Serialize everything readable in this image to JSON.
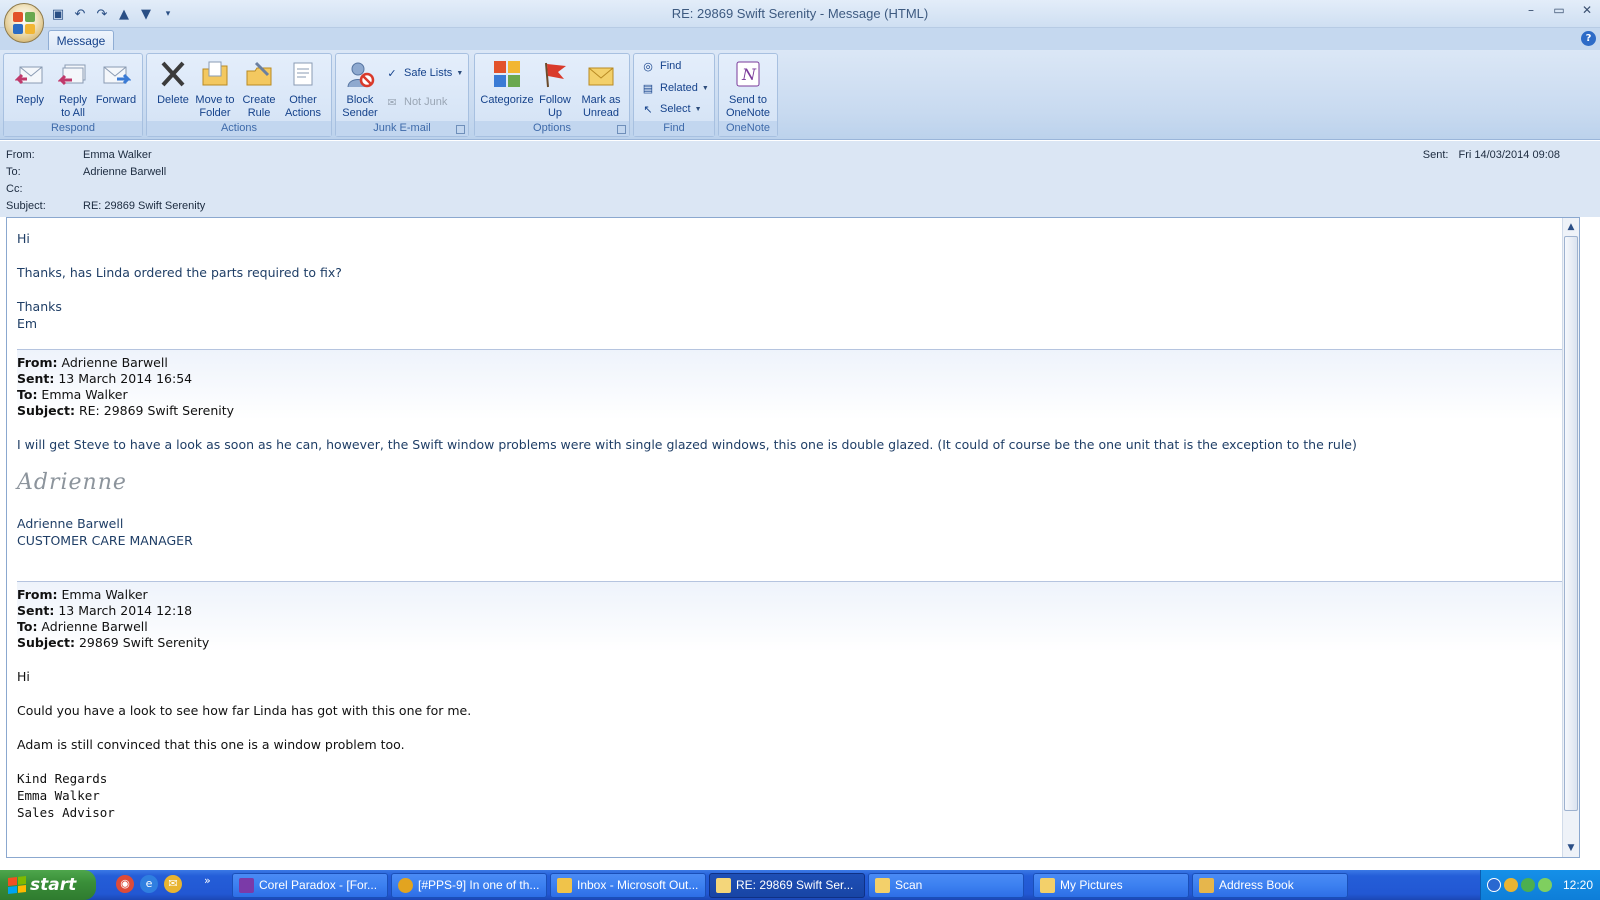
{
  "window": {
    "title": "RE: 29869  Swift Serenity - Message (HTML)",
    "controls": [
      "–",
      "▭",
      "✕"
    ]
  },
  "tabs": [
    {
      "label": "Message"
    }
  ],
  "ribbon": {
    "groups": [
      {
        "label": "Respond",
        "buttons": [
          "Reply",
          "Reply\nto All",
          "Forward"
        ]
      },
      {
        "label": "Actions",
        "buttons": [
          "Delete",
          "Move to\nFolder",
          "Create\nRule",
          "Other\nActions"
        ]
      },
      {
        "label": "Junk E-mail",
        "buttons": [
          "Block\nSender"
        ],
        "small": [
          "Safe Lists",
          "Not Junk"
        ]
      },
      {
        "label": "Options",
        "buttons": [
          "Categorize",
          "Follow\nUp",
          "Mark as\nUnread"
        ]
      },
      {
        "label": "Find",
        "small": [
          "Find",
          "Related",
          "Select"
        ]
      },
      {
        "label": "OneNote",
        "buttons": [
          "Send to\nOneNote"
        ]
      }
    ]
  },
  "header": {
    "from_label": "From:",
    "from": "Emma Walker",
    "to_label": "To:",
    "to": "Adrienne Barwell",
    "cc_label": "Cc:",
    "cc": "",
    "subject_label": "Subject:",
    "subject": "RE: 29869  Swift Serenity",
    "sent_label": "Sent:",
    "sent": "Fri 14/03/2014 09:08"
  },
  "body": {
    "greeting": "Hi",
    "line1": "Thanks, has Linda ordered the parts required to fix?",
    "signoff1": "Thanks",
    "signoff2": "Em",
    "quote1": {
      "from_label": "From:",
      "from": " Adrienne Barwell",
      "sent_label": "Sent:",
      "sent": " 13 March 2014 16:54",
      "to_label": "To:",
      "to": " Emma Walker",
      "subject_label": "Subject:",
      "subject": " RE: 29869 Swift Serenity",
      "text": "I will get Steve to have a look as soon as he can, however, the Swift window problems were with single glazed windows, this one is double glazed. (It could of course be the one unit that is the exception to the rule)",
      "signature": "Adrienne",
      "name": "Adrienne Barwell",
      "role": "CUSTOMER CARE MANAGER"
    },
    "quote2": {
      "from_label": "From:",
      "from": " Emma Walker",
      "sent_label": "Sent:",
      "sent": " 13 March 2014 12:18",
      "to_label": "To:",
      "to": " Adrienne Barwell",
      "subject_label": "Subject:",
      "subject": " 29869 Swift Serenity",
      "greeting": "Hi",
      "line1": "Could you have a look to see how far Linda has got with this one for me.",
      "line2": "Adam is still convinced that this one is a window problem too.",
      "sig1": "Kind Regards",
      "sig2": "Emma Walker",
      "sig3": "Sales Advisor"
    }
  },
  "taskbar": {
    "start": "start",
    "items": [
      {
        "label": "Corel Paradox - [For...",
        "color": "#7b3aa8"
      },
      {
        "label": "[#PPS-9] In one of th...",
        "color": "#e2a420"
      },
      {
        "label": "Inbox - Microsoft Out...",
        "color": "#f0c34a"
      },
      {
        "label": "RE: 29869  Swift Ser...",
        "color": "#f4d67a"
      },
      {
        "label": "Scan",
        "color": "#f3d06a"
      },
      {
        "label": "My Pictures",
        "color": "#f3d06a"
      },
      {
        "label": "Address Book",
        "color": "#e6b64c"
      }
    ],
    "clock": "12:20"
  },
  "colors": {
    "ribbon_text": "#15428b",
    "accent": "#2d6bc7",
    "taskbar": "#245ed8"
  }
}
